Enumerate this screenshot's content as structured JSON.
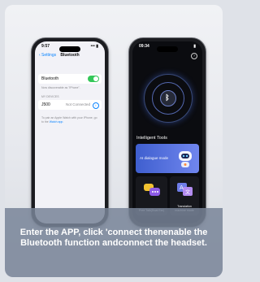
{
  "left_phone": {
    "status_time": "9:57",
    "status_signal": "••• ▮",
    "nav_back": "‹ Settings",
    "nav_title": "Bluetooth",
    "bluetooth_label": "Bluetooth",
    "bluetooth_on": true,
    "discoverable_text": "Now discoverable as \"iPhone\".",
    "section_header": "MY DEVICES",
    "device_name": "J500",
    "device_status": "Not Connected",
    "pair_note": "To pair an Apple Watch with your iPhone, go to the",
    "pair_link": "Watch app."
  },
  "right_phone": {
    "status_time": "09:34",
    "status_signal": "▮",
    "help_icon": "?",
    "bluetooth_symbol": "ᛒ",
    "section_title": "Intelligent Tools",
    "tiles": {
      "ai_dialogue": "AI dialogue mode",
      "free_talk": "Free Talk(Dual Ear)",
      "translation": "Translation machine mode"
    }
  },
  "caption": "Enter the APP, click 'connect thenenable the Bluetooth function andconnect the headset.",
  "colors": {
    "accent_blue": "#0a84ff",
    "toggle_green": "#34c759",
    "tile_blue": "#4f6ee0"
  }
}
